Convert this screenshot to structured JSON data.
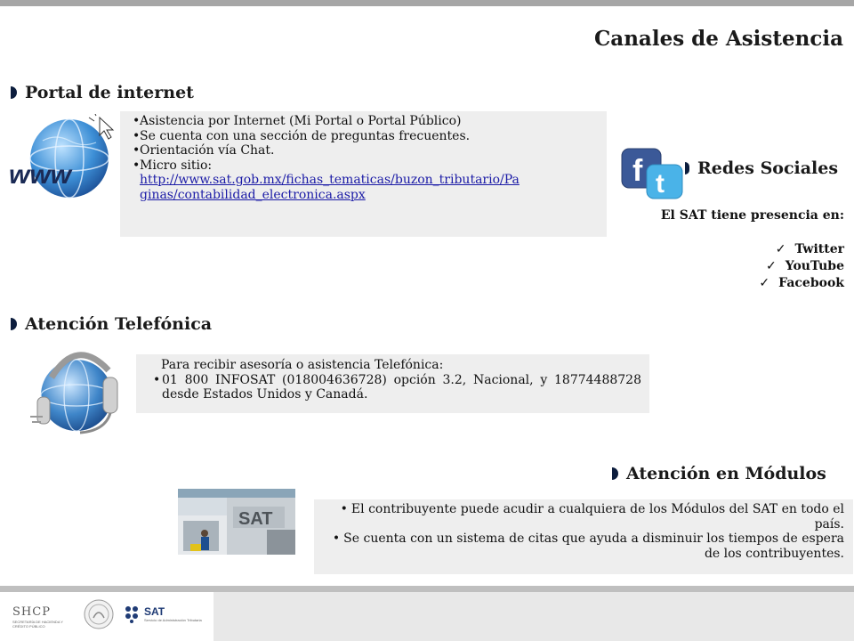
{
  "title": "Canales de Asistencia",
  "portal": {
    "heading": "Portal de internet",
    "items": [
      "Asistencia por Internet (Mi Portal o Portal Público)",
      "Se cuenta con una sección de preguntas frecuentes.",
      "Orientación vía Chat.",
      "Micro sitio:"
    ],
    "url": "http://www.sat.gob.mx/fichas_tematicas/buzon_tributario/Paginas/contabilidad_electronica.aspx",
    "url_line1": "http://www.sat.gob.mx/fichas_tematicas/buzon_tributario/Pa",
    "url_line2": "ginas/contabilidad_electronica.aspx",
    "image_text": "www"
  },
  "redes": {
    "heading": "Redes Sociales",
    "intro": "El SAT tiene presencia en:",
    "items": [
      "Twitter",
      "YouTube",
      "Facebook"
    ],
    "icon_f": "f",
    "icon_t": "t"
  },
  "telefonica": {
    "heading": "Atención Telefónica",
    "intro": "Para recibir asesoría o asistencia Telefónica:",
    "item": "01 800 INFOSAT (018004636728) opción 3.2, Nacional, y 18774488728 desde Estados Unidos y Canadá."
  },
  "modulos": {
    "heading": "Atención en Módulos",
    "items": [
      "El contribuyente puede acudir a cualquiera de los Módulos del SAT en todo el  país.",
      "Se cuenta con un sistema de citas que ayuda a disminuir los tiempos de espera de los contribuyentes."
    ],
    "photo_sign": "SAT"
  },
  "footer": {
    "shcp": "SHCP",
    "shcp_sub": "SECRETARÍA DE HACIENDA Y CRÉDITO PÚBLICO",
    "sat": "SAT",
    "sat_sub": "Servicio de Administración Tributaria"
  },
  "colors": {
    "marker": "#0c1d3d",
    "box_bg": "#eeeeee",
    "link": "#1a1aa6",
    "top_bar": "#a6a6a6"
  }
}
